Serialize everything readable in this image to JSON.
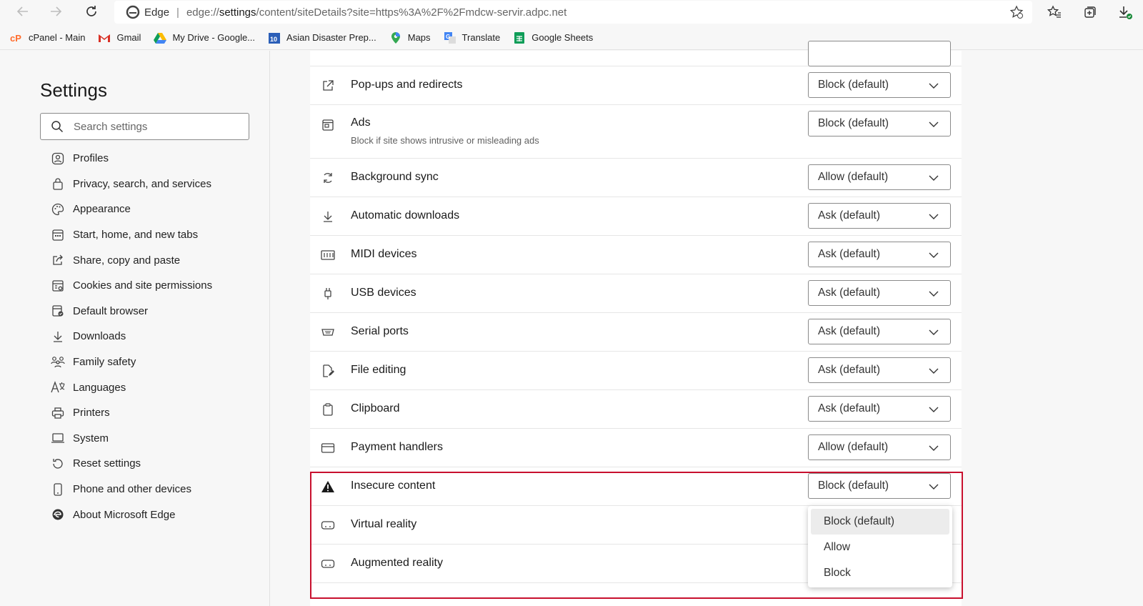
{
  "browser": {
    "edge_label": "Edge",
    "url_prefix": "edge://",
    "url_host": "settings",
    "url_rest": "/content/siteDetails?site=https%3A%2F%2Fmdcw-servir.adpc.net"
  },
  "bookmarks": [
    {
      "label": "cPanel - Main",
      "icon": "cpanel-icon"
    },
    {
      "label": "Gmail",
      "icon": "gmail-icon"
    },
    {
      "label": "My Drive - Google...",
      "icon": "drive-icon"
    },
    {
      "label": "Asian Disaster Prep...",
      "icon": "calendar-icon"
    },
    {
      "label": "Maps",
      "icon": "maps-icon"
    },
    {
      "label": "Translate",
      "icon": "translate-icon"
    },
    {
      "label": "Google Sheets",
      "icon": "sheets-icon"
    }
  ],
  "sidebar": {
    "title": "Settings",
    "search_placeholder": "Search settings",
    "items": [
      {
        "label": "Profiles",
        "icon": "profile-icon"
      },
      {
        "label": "Privacy, search, and services",
        "icon": "lock-icon"
      },
      {
        "label": "Appearance",
        "icon": "palette-icon"
      },
      {
        "label": "Start, home, and new tabs",
        "icon": "home-tabs-icon"
      },
      {
        "label": "Share, copy and paste",
        "icon": "share-icon"
      },
      {
        "label": "Cookies and site permissions",
        "icon": "cookies-icon"
      },
      {
        "label": "Default browser",
        "icon": "default-browser-icon"
      },
      {
        "label": "Downloads",
        "icon": "download-icon"
      },
      {
        "label": "Family safety",
        "icon": "family-icon"
      },
      {
        "label": "Languages",
        "icon": "languages-icon"
      },
      {
        "label": "Printers",
        "icon": "printer-icon"
      },
      {
        "label": "System",
        "icon": "laptop-icon"
      },
      {
        "label": "Reset settings",
        "icon": "reset-icon"
      },
      {
        "label": "Phone and other devices",
        "icon": "phone-icon"
      },
      {
        "label": "About Microsoft Edge",
        "icon": "edge-logo-icon"
      }
    ]
  },
  "permissions": [
    {
      "label": "Pop-ups and redirects",
      "value": "Block (default)",
      "icon": "popup-icon"
    },
    {
      "label": "Ads",
      "desc": "Block if site shows intrusive or misleading ads",
      "value": "Block (default)",
      "icon": "ads-icon"
    },
    {
      "label": "Background sync",
      "value": "Allow (default)",
      "icon": "sync-icon"
    },
    {
      "label": "Automatic downloads",
      "value": "Ask (default)",
      "icon": "download-icon"
    },
    {
      "label": "MIDI devices",
      "value": "Ask (default)",
      "icon": "midi-icon"
    },
    {
      "label": "USB devices",
      "value": "Ask (default)",
      "icon": "usb-icon"
    },
    {
      "label": "Serial ports",
      "value": "Ask (default)",
      "icon": "serial-icon"
    },
    {
      "label": "File editing",
      "value": "Ask (default)",
      "icon": "file-edit-icon"
    },
    {
      "label": "Clipboard",
      "value": "Ask (default)",
      "icon": "clipboard-icon"
    },
    {
      "label": "Payment handlers",
      "value": "Allow (default)",
      "icon": "card-icon"
    },
    {
      "label": "Insecure content",
      "value": "Block (default)",
      "icon": "warning-icon"
    },
    {
      "label": "Virtual reality",
      "icon": "vr-icon"
    },
    {
      "label": "Augmented reality",
      "icon": "ar-icon"
    }
  ],
  "dropdown": {
    "options": [
      "Block (default)",
      "Allow",
      "Block"
    ],
    "selected": "Block (default)"
  },
  "colors": {
    "highlight": "#c8102e",
    "accent": "#0067c0"
  }
}
